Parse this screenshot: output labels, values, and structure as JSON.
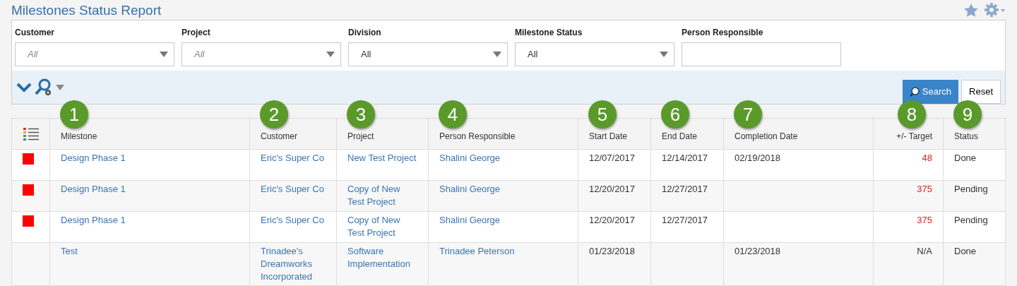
{
  "title": "Milestones Status Report",
  "filters": [
    {
      "label": "Customer",
      "kind": "select",
      "placeholder": "All"
    },
    {
      "label": "Project",
      "kind": "select",
      "placeholder": "All"
    },
    {
      "label": "Division",
      "kind": "select",
      "value": "All"
    },
    {
      "label": "Milestone Status",
      "kind": "select",
      "value": "All"
    },
    {
      "label": "Person Responsible",
      "kind": "text"
    }
  ],
  "buttons": {
    "search": "Search",
    "reset": "Reset"
  },
  "table": {
    "columns": [
      {
        "label": "Milestone",
        "callout": "1"
      },
      {
        "label": "Customer",
        "callout": "2"
      },
      {
        "label": "Project",
        "callout": "3"
      },
      {
        "label": "Person Responsible",
        "callout": "4"
      },
      {
        "label": "Start Date",
        "callout": "5"
      },
      {
        "label": "End Date",
        "callout": "6"
      },
      {
        "label": "Completion Date",
        "callout": "7"
      },
      {
        "label": "+/- Target",
        "callout": "8"
      },
      {
        "label": "Status",
        "callout": "9"
      }
    ],
    "rows": [
      {
        "flag": true,
        "late": true,
        "cells": [
          "Design Phase 1",
          "Eric's Super Co",
          "New Test Project",
          "Shalini George",
          "12/07/2017",
          "12/14/2017",
          "02/19/2018",
          "48",
          "Done"
        ]
      },
      {
        "flag": true,
        "late": true,
        "cells": [
          "Design Phase 1",
          "Eric's Super Co",
          "Copy of New Test Project",
          "Shalini George",
          "12/20/2017",
          "12/27/2017",
          "",
          "375",
          "Pending"
        ]
      },
      {
        "flag": true,
        "late": true,
        "cells": [
          "Design Phase 1",
          "Eric's Super Co",
          "Copy of New Test Project",
          "Shalini George",
          "12/20/2017",
          "12/27/2017",
          "",
          "375",
          "Pending"
        ]
      },
      {
        "flag": false,
        "late": false,
        "cells": [
          "Test",
          "Trinadee's Dreamworks Incorporated",
          "Software Implementation",
          "Trinadee Peterson",
          "01/23/2018",
          "",
          "01/23/2018",
          "N/A",
          "Done"
        ]
      }
    ]
  }
}
